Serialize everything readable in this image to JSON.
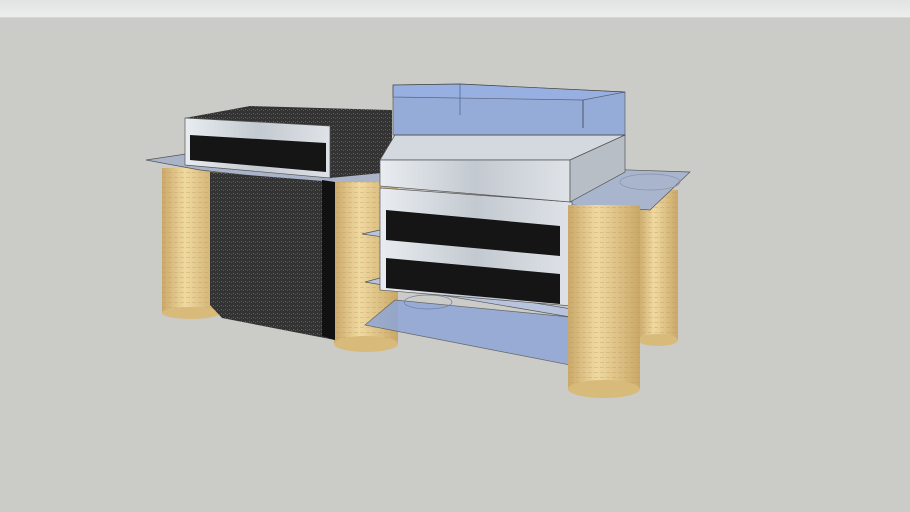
{
  "colors": {
    "background": "#cbcbc7",
    "stone": "#e3c98a",
    "granite": "#3a3a3a",
    "steel": "#c9cfd6",
    "glass": "#7f9fe0",
    "slot": "#151515"
  }
}
